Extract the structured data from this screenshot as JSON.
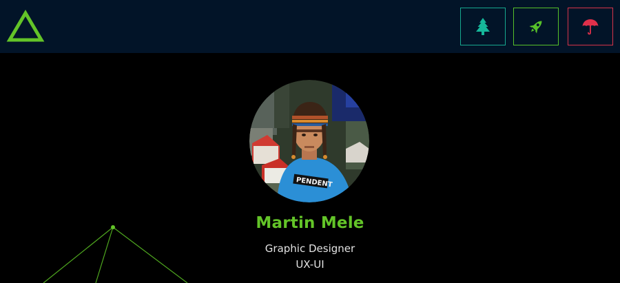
{
  "header": {
    "logo_icon": "triangle-logo-icon",
    "nav": [
      {
        "icon": "tree-icon",
        "color": "#16a98f"
      },
      {
        "icon": "rocket-icon",
        "color": "#57c12a"
      },
      {
        "icon": "umbrella-icon",
        "color": "#d8344a"
      }
    ]
  },
  "profile": {
    "name": "Martin Mele",
    "title_line1": "Graphic Designer",
    "title_line2": "UX-UI"
  },
  "colors": {
    "header_bg": "#021428",
    "page_bg": "#000000",
    "accent_green": "#63c428",
    "teal": "#16a98f",
    "red": "#d8344a"
  }
}
